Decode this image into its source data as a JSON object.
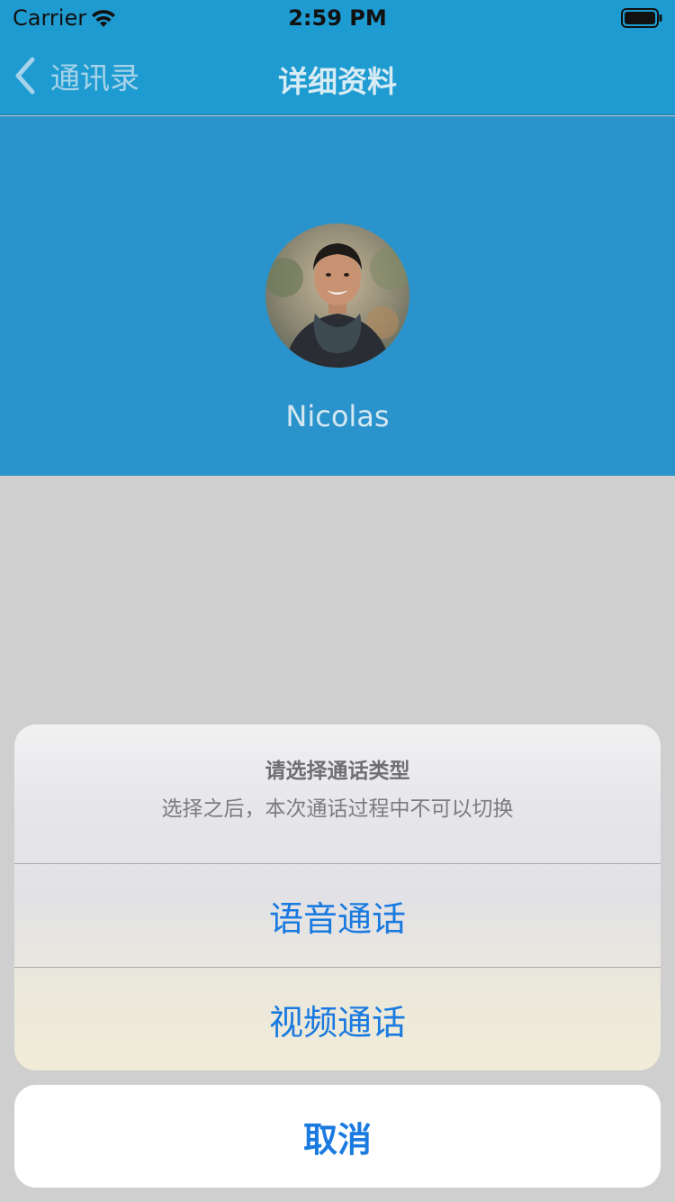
{
  "status_bar": {
    "carrier": "Carrier",
    "time": "2:59 PM",
    "wifi_icon": "wifi-icon",
    "battery_icon": "battery-icon"
  },
  "nav": {
    "back_label": "通讯录",
    "back_icon": "chevron-left-icon",
    "title": "详细资料"
  },
  "profile": {
    "name": "Nicolas",
    "avatar": "avatar-photo"
  },
  "action_sheet": {
    "title": "请选择通话类型",
    "message": "选择之后，本次通话过程中不可以切换",
    "options": [
      {
        "label": "语音通话"
      },
      {
        "label": "视频通话"
      }
    ],
    "cancel_label": "取消"
  },
  "colors": {
    "nav_bg": "#1e9bd0",
    "header_bg": "#2b93cc",
    "dim_bg": "#cfcfcf",
    "action_blue": "#1a7ae0"
  }
}
